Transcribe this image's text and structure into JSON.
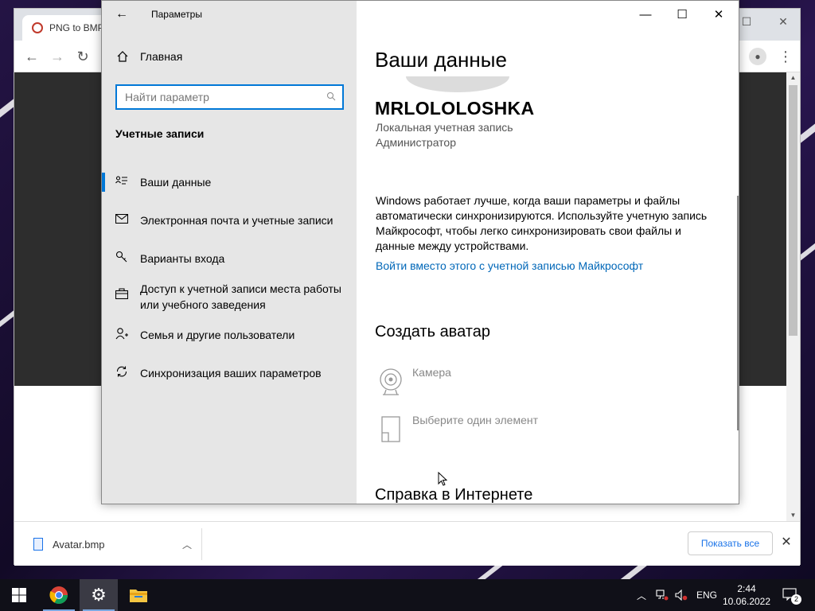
{
  "browser": {
    "tab_title": "PNG to BMP"
  },
  "downloads": {
    "file_name": "Avatar.bmp",
    "show_all_label": "Показать все"
  },
  "settings": {
    "window_title": "Параметры",
    "home_label": "Главная",
    "search_placeholder": "Найти параметр",
    "section_title": "Учетные записи",
    "nav_items": [
      {
        "label": "Ваши данные",
        "icon": "person-card-icon",
        "active": true
      },
      {
        "label": "Электронная почта и учетные записи",
        "icon": "mail-icon",
        "active": false
      },
      {
        "label": "Варианты входа",
        "icon": "key-icon",
        "active": false
      },
      {
        "label": "Доступ к учетной записи места работы или учебного заведения",
        "icon": "briefcase-icon",
        "active": false
      },
      {
        "label": "Семья и другие пользователи",
        "icon": "person-add-icon",
        "active": false
      },
      {
        "label": "Синхронизация ваших параметров",
        "icon": "sync-icon",
        "active": false
      }
    ],
    "main": {
      "page_title": "Ваши данные",
      "username": "MRLOLOLOSHKA",
      "account_type": "Локальная учетная запись",
      "account_role": "Администратор",
      "description": "Windows работает лучше, когда ваши параметры и файлы автоматически синхронизируются. Используйте учетную запись Майкрософт, чтобы легко синхронизировать свои файлы и данные между устройствами.",
      "ms_link": "Войти вместо этого с учетной записью Майкрософт",
      "create_avatar_heading": "Создать аватар",
      "camera_label": "Камера",
      "browse_label": "Выберите один элемент",
      "help_heading": "Справка в Интернете"
    }
  },
  "taskbar": {
    "language": "ENG",
    "time": "2:44",
    "date": "10.06.2022",
    "notification_count": "2"
  },
  "colors": {
    "accent": "#0078d7",
    "link": "#0067b8",
    "sidebar_bg": "#e6e6e6",
    "taskbar_bg": "#101018"
  }
}
